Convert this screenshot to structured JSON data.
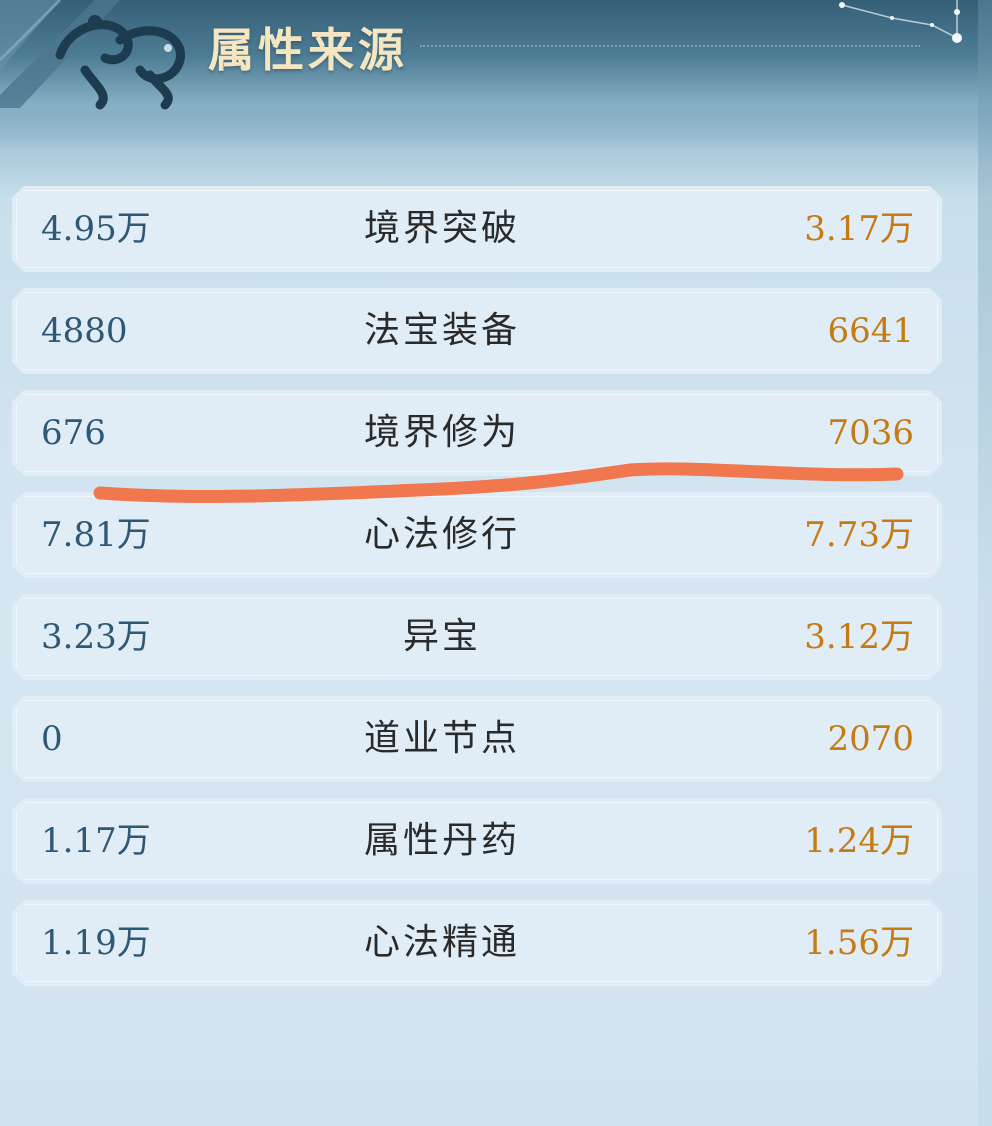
{
  "title": "属性来源",
  "colors": {
    "left_value": "#2f5875",
    "right_value": "#c57a12",
    "label": "#2a2a2a",
    "row_bg": "#e0edf6",
    "title": "#f4e6c0",
    "annotation_stroke": "#f0774e"
  },
  "icons": {
    "emblem": "auspicious-beast-emblem-icon",
    "constellation": "constellation-decoration-icon"
  },
  "rows": [
    {
      "left": "4.95万",
      "label": "境界突破",
      "right": "3.17万"
    },
    {
      "left": "4880",
      "label": "法宝装备",
      "right": "6641"
    },
    {
      "left": "676",
      "label": "境界修为",
      "right": "7036"
    },
    {
      "left": "7.81万",
      "label": "心法修行",
      "right": "7.73万"
    },
    {
      "left": "3.23万",
      "label": "异宝",
      "right": "3.12万"
    },
    {
      "left": "0",
      "label": "道业节点",
      "right": "2070"
    },
    {
      "left": "1.17万",
      "label": "属性丹药",
      "right": "1.24万"
    },
    {
      "left": "1.19万",
      "label": "心法精通",
      "right": "1.56万"
    }
  ]
}
